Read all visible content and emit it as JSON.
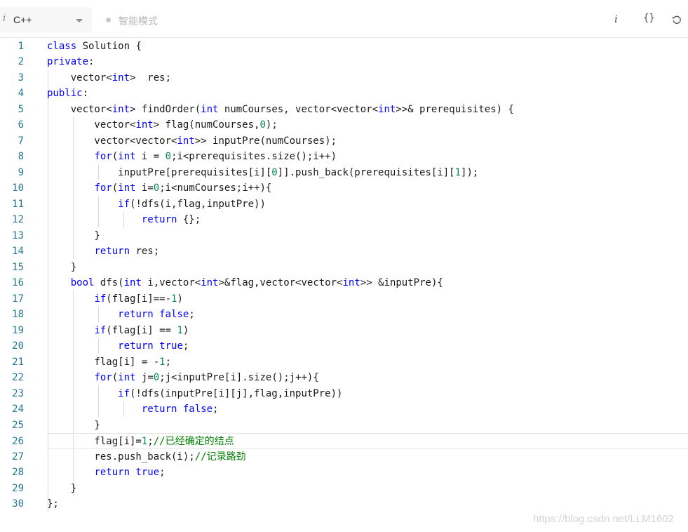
{
  "toolbar": {
    "language": "C++",
    "mode_label": "智能模式",
    "info_icon": "i",
    "format_icon": "{}",
    "reset_icon": "reset-icon"
  },
  "code_lines": [
    {
      "n": "1",
      "text": "class Solution {"
    },
    {
      "n": "2",
      "text": "private:"
    },
    {
      "n": "3",
      "text": "    vector<int>  res;"
    },
    {
      "n": "4",
      "text": "public:"
    },
    {
      "n": "5",
      "text": "    vector<int> findOrder(int numCourses, vector<vector<int>>& prerequisites) {"
    },
    {
      "n": "6",
      "text": "        vector<int> flag(numCourses,0);"
    },
    {
      "n": "7",
      "text": "        vector<vector<int>> inputPre(numCourses);"
    },
    {
      "n": "8",
      "text": "        for(int i = 0;i<prerequisites.size();i++)"
    },
    {
      "n": "9",
      "text": "            inputPre[prerequisites[i][0]].push_back(prerequisites[i][1]);"
    },
    {
      "n": "10",
      "text": "        for(int i=0;i<numCourses;i++){"
    },
    {
      "n": "11",
      "text": "            if(!dfs(i,flag,inputPre))"
    },
    {
      "n": "12",
      "text": "                return {};"
    },
    {
      "n": "13",
      "text": "        }"
    },
    {
      "n": "14",
      "text": "        return res;"
    },
    {
      "n": "15",
      "text": "    }"
    },
    {
      "n": "16",
      "text": "    bool dfs(int i,vector<int>&flag,vector<vector<int>> &inputPre){"
    },
    {
      "n": "17",
      "text": "        if(flag[i]==-1)"
    },
    {
      "n": "18",
      "text": "            return false;"
    },
    {
      "n": "19",
      "text": "        if(flag[i] == 1)"
    },
    {
      "n": "20",
      "text": "            return true;"
    },
    {
      "n": "21",
      "text": "        flag[i] = -1;"
    },
    {
      "n": "22",
      "text": "        for(int j=0;j<inputPre[i].size();j++){"
    },
    {
      "n": "23",
      "text": "            if(!dfs(inputPre[i][j],flag,inputPre))"
    },
    {
      "n": "24",
      "text": "                return false;"
    },
    {
      "n": "25",
      "text": "        }"
    },
    {
      "n": "26",
      "text": "        flag[i]=1;//已经确定的结点"
    },
    {
      "n": "27",
      "text": "        res.push_back(i);//记录路劲"
    },
    {
      "n": "28",
      "text": "        return true;"
    },
    {
      "n": "29",
      "text": "    }"
    },
    {
      "n": "30",
      "text": "};"
    }
  ],
  "active_line": 26,
  "watermark": "https://blog.csdn.net/LLM1602",
  "colors": {
    "keyword": "#0000ff",
    "number": "#098658",
    "comment": "#008000",
    "line_number": "#237893"
  }
}
